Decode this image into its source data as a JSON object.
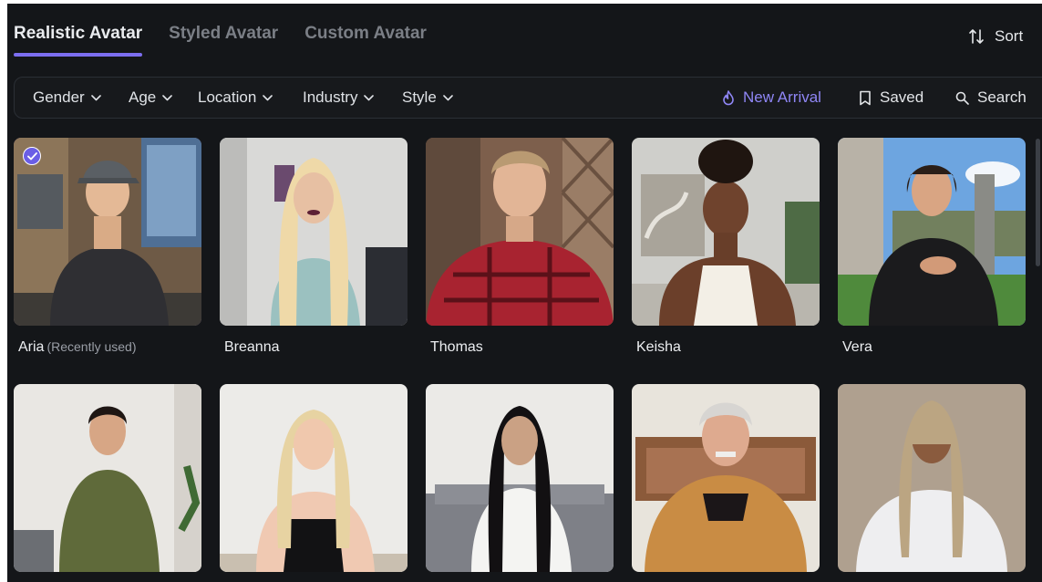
{
  "tabs": [
    {
      "label": "Realistic Avatar",
      "active": true
    },
    {
      "label": "Styled Avatar",
      "active": false
    },
    {
      "label": "Custom Avatar",
      "active": false
    }
  ],
  "sort": {
    "label": "Sort",
    "icon": "sort-arrows-icon"
  },
  "filters": [
    {
      "label": "Gender",
      "icon": "chevron-down-icon"
    },
    {
      "label": "Age",
      "icon": "chevron-down-icon"
    },
    {
      "label": "Location",
      "icon": "chevron-down-icon"
    },
    {
      "label": "Industry",
      "icon": "chevron-down-icon"
    },
    {
      "label": "Style",
      "icon": "chevron-down-icon"
    }
  ],
  "actions": [
    {
      "label": "New Arrival",
      "icon": "flame-icon"
    },
    {
      "label": "Saved",
      "icon": "bookmark-icon"
    },
    {
      "label": "Search",
      "icon": "search-icon"
    }
  ],
  "avatars": [
    {
      "name": "Aria",
      "note": "(Recently used)",
      "selected": true
    },
    {
      "name": "Breanna",
      "note": "",
      "selected": false
    },
    {
      "name": "Thomas",
      "note": "",
      "selected": false
    },
    {
      "name": "Keisha",
      "note": "",
      "selected": false
    },
    {
      "name": "Vera",
      "note": "",
      "selected": false
    },
    {
      "name": "",
      "note": "",
      "selected": false
    },
    {
      "name": "",
      "note": "",
      "selected": false
    },
    {
      "name": "",
      "note": "",
      "selected": false
    },
    {
      "name": "",
      "note": "",
      "selected": false
    },
    {
      "name": "",
      "note": "",
      "selected": false
    }
  ],
  "colors": {
    "accent": "#7c6ef0",
    "background": "#141619",
    "text": "#e9ebee",
    "muted": "#7b7f86"
  }
}
